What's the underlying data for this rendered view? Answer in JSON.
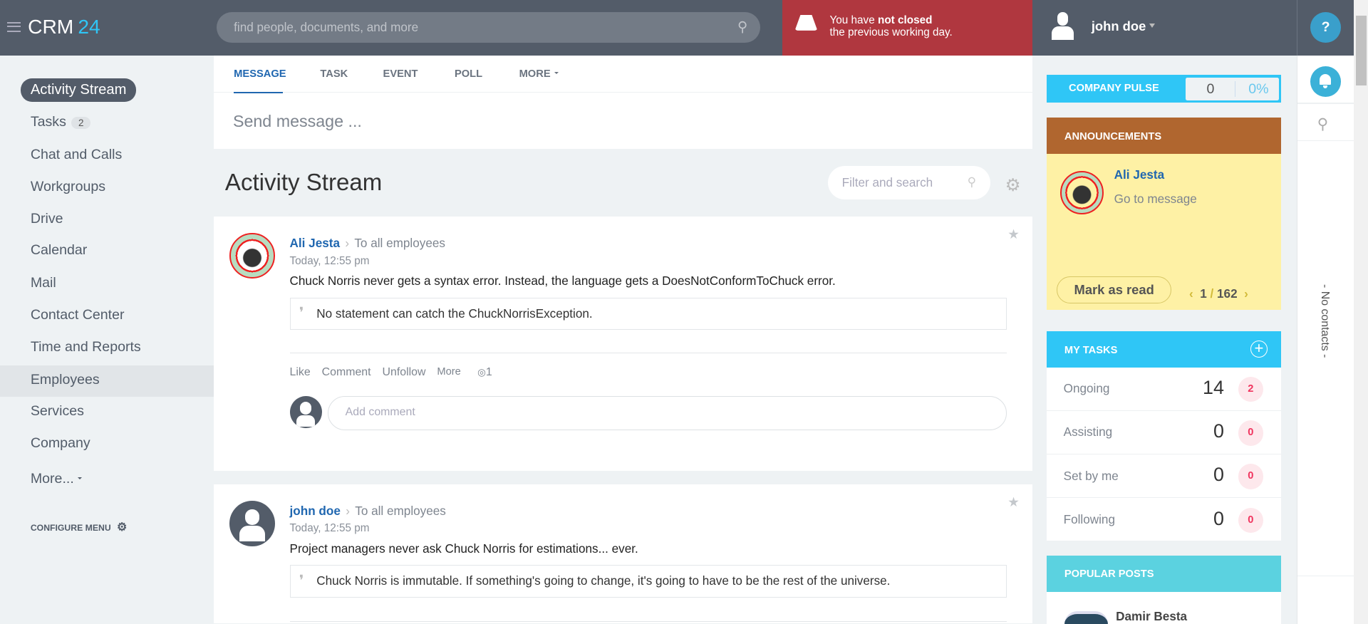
{
  "header": {
    "logo_text": "CRM",
    "logo_number": "24",
    "search_placeholder": "find people, documents, and more",
    "warning_pre": "You have ",
    "warning_bold": "not closed",
    "warning_line2": "the previous working day.",
    "user_name": "john doe",
    "help_label": "?"
  },
  "sidebar": {
    "items": [
      {
        "label": "Activity Stream"
      },
      {
        "label": "Tasks",
        "count": "2"
      },
      {
        "label": "Chat and Calls"
      },
      {
        "label": "Workgroups"
      },
      {
        "label": "Drive"
      },
      {
        "label": "Calendar"
      },
      {
        "label": "Mail"
      },
      {
        "label": "Contact Center"
      },
      {
        "label": "Time and Reports"
      },
      {
        "label": "Employees"
      },
      {
        "label": "Services"
      },
      {
        "label": "Company"
      },
      {
        "label": "More..."
      }
    ],
    "configure_label": "CONFIGURE MENU"
  },
  "composer": {
    "tabs": [
      "MESSAGE",
      "TASK",
      "EVENT",
      "POLL",
      "MORE"
    ],
    "placeholder": "Send message ..."
  },
  "stream": {
    "title": "Activity Stream",
    "filter_placeholder": "Filter and search"
  },
  "posts": [
    {
      "author": "Ali Jesta",
      "audience": "To all employees",
      "time": "Today, 12:55 pm",
      "text": "Chuck Norris never gets a syntax error. Instead, the language gets a DoesNotConformToChuck error.",
      "quote": "No statement can catch the ChuckNorrisException.",
      "actions": [
        "Like",
        "Comment",
        "Unfollow",
        "More"
      ],
      "views": "1",
      "comment_placeholder": "Add comment"
    },
    {
      "author": "john doe",
      "audience": "To all employees",
      "time": "Today, 12:55 pm",
      "text": "Project managers never ask Chuck Norris for estimations... ever.",
      "quote": "Chuck Norris is immutable. If something's going to change, it's going to have to be the rest of the universe."
    }
  ],
  "pulse": {
    "label": "COMPANY PULSE",
    "value": "0",
    "percent": "0%"
  },
  "announcements": {
    "title": "ANNOUNCEMENTS",
    "author": "Ali Jesta",
    "link": "Go to message",
    "mark_read": "Mark as read",
    "current": "1",
    "total": "162"
  },
  "my_tasks": {
    "title": "MY TASKS",
    "rows": [
      {
        "label": "Ongoing",
        "count": "14",
        "badge": "2"
      },
      {
        "label": "Assisting",
        "count": "0",
        "badge": "0"
      },
      {
        "label": "Set by me",
        "count": "0",
        "badge": "0"
      },
      {
        "label": "Following",
        "count": "0",
        "badge": "0"
      }
    ]
  },
  "popular": {
    "title": "POPULAR POSTS",
    "author": "Damir Besta"
  },
  "rail": {
    "no_contacts": "- No contacts -"
  },
  "colors": {
    "header": "#535c69",
    "warning": "#b0373f",
    "accent": "#2fc6f6",
    "announcements": "#b0662f",
    "announcement_body": "#fef1a5",
    "popular": "#5bd2e0",
    "link": "#2067b0"
  }
}
